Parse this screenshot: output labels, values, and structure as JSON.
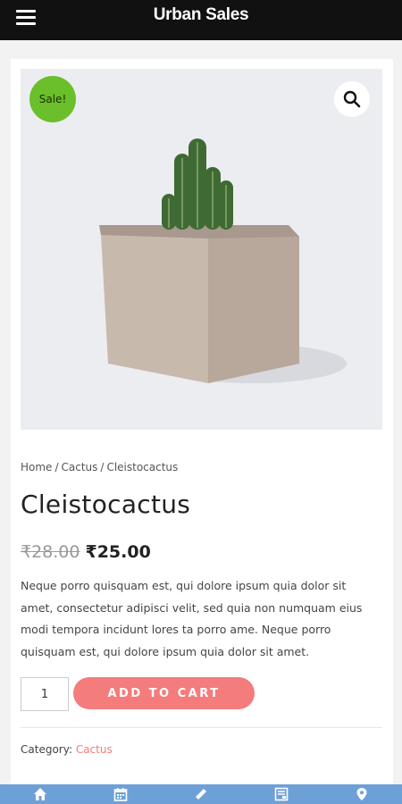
{
  "app": {
    "title": "Urban Sales"
  },
  "product": {
    "sale_badge": "Sale!",
    "breadcrumb": {
      "home": "Home",
      "sep": "/",
      "category": "Cactus",
      "current": "Cleistocactus"
    },
    "title": "Cleistocactus",
    "old_price": "₹28.00",
    "new_price": "₹25.00",
    "description": "Neque porro quisquam est, qui dolore ipsum quia dolor sit amet, consectetur adipisci velit, sed quia non numquam eius modi tempora incidunt lores ta porro ame. Neque porro quisquam est, qui dolore ipsum quia dolor sit amet.",
    "quantity": "1",
    "add_to_cart_label": "ADD TO CART",
    "category_label": "Category:",
    "category_value": "Cactus"
  },
  "bottom_nav": {
    "items": [
      {
        "icon": "home-icon"
      },
      {
        "icon": "calendar-icon"
      },
      {
        "icon": "pencil-icon"
      },
      {
        "icon": "list-icon"
      },
      {
        "icon": "location-pin-icon"
      }
    ]
  },
  "colors": {
    "topbar": "#111111",
    "sale_badge": "#6bbf2a",
    "accent": "#f47c7c",
    "bottom_nav": "#6ea0d8"
  }
}
